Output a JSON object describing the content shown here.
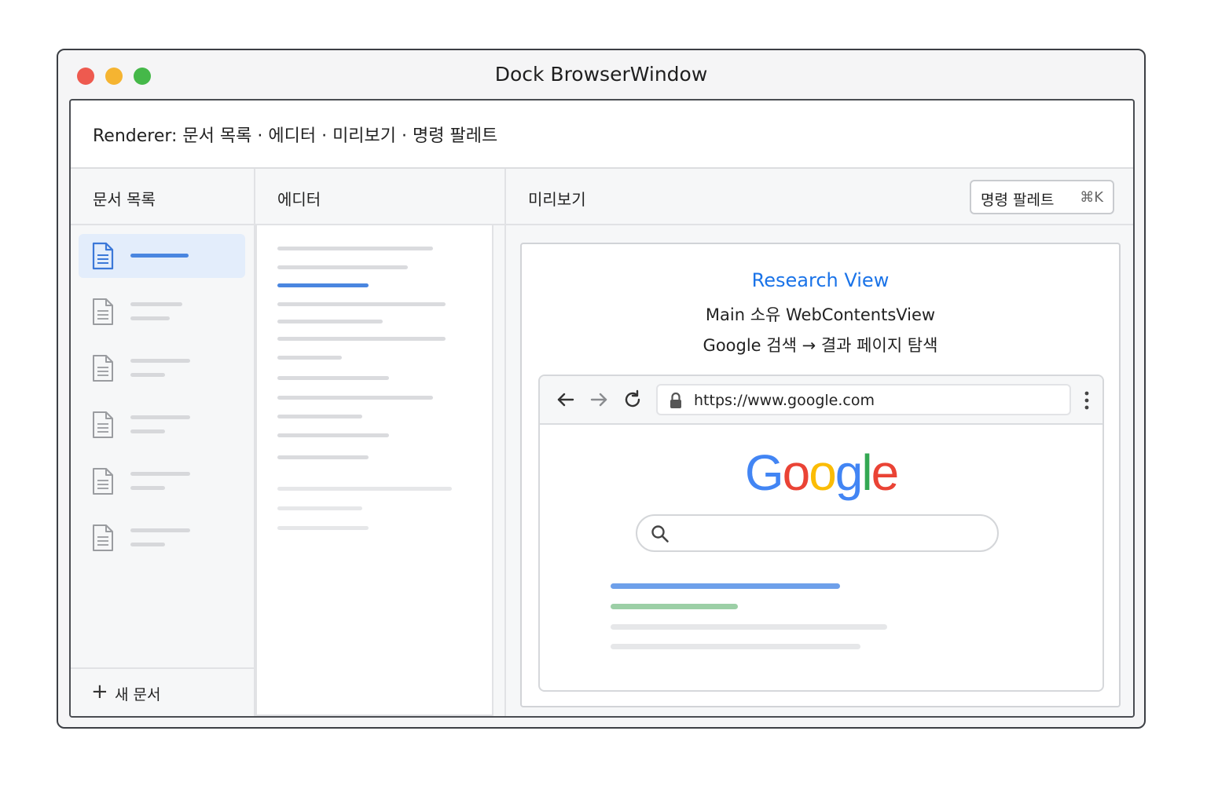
{
  "window": {
    "title": "Dock BrowserWindow"
  },
  "renderer": {
    "header": "Renderer: 문서 목록 · 에디터 · 미리보기 · 명령 팔레트"
  },
  "sidebar": {
    "title": "문서 목록",
    "new_doc_label": "새 문서",
    "new_doc_icon": "plus-icon",
    "doc_icon": "document-icon",
    "item_count_visible": 6,
    "active_index": 0
  },
  "editor": {
    "title": "에디터"
  },
  "preview": {
    "title": "미리보기",
    "palette_button": {
      "label": "명령 팔레트",
      "shortcut": "⌘K"
    },
    "card": {
      "title": "Research View",
      "subtitle": "Main 소유 WebContentsView",
      "flow": "Google 검색 → 결과 페이지 탐색"
    },
    "browser": {
      "url": "https://www.google.com",
      "logo": "Google",
      "logo_colors": [
        "#4285F4",
        "#EA4335",
        "#FBBC05",
        "#4285F4",
        "#34A853",
        "#EA4335"
      ]
    }
  },
  "colors": {
    "accent": "#1a73e8",
    "active_item_bg": "#e3edfb",
    "traffic_red": "#ee5a4f",
    "traffic_yellow": "#f5b431",
    "traffic_green": "#45b849"
  }
}
